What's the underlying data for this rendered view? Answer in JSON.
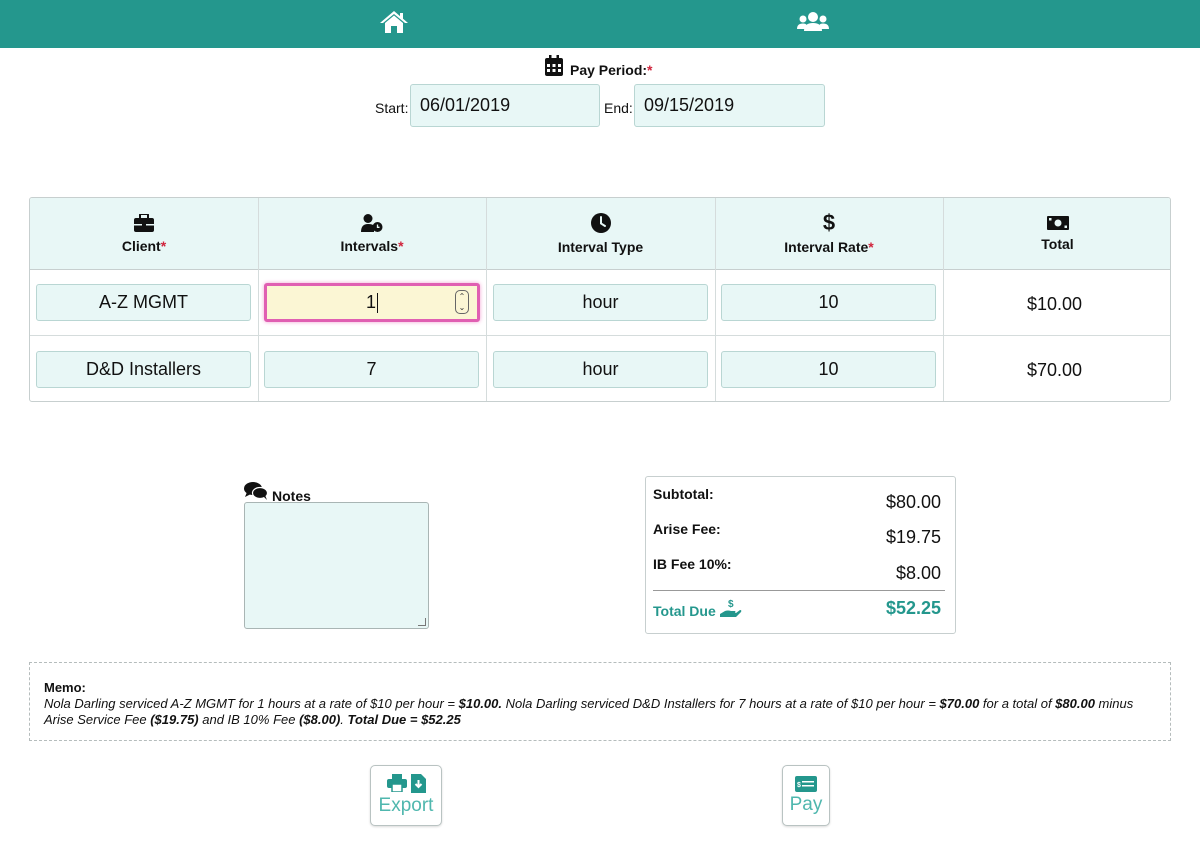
{
  "nav": {
    "home_icon": "home-icon",
    "users_icon": "users-icon"
  },
  "pay_period": {
    "title": "Pay Period:",
    "required_mark": "*",
    "start_label": "Start:",
    "start_value": "06/01/2019",
    "end_label": "End:",
    "end_value": "09/15/2019"
  },
  "table": {
    "headers": [
      {
        "label": "Client",
        "required": "*",
        "icon": "briefcase-icon"
      },
      {
        "label": "Intervals",
        "required": "*",
        "icon": "user-clock-icon"
      },
      {
        "label": "Interval Type",
        "required": "",
        "icon": "clock-icon"
      },
      {
        "label": "Interval Rate",
        "required": "*",
        "icon": "dollar-icon"
      },
      {
        "label": "Total",
        "required": "",
        "icon": "money-bill-icon"
      }
    ],
    "rows": [
      {
        "client": "A-Z MGMT",
        "intervals": "1",
        "interval_type": "hour",
        "rate": "10",
        "total": "$10.00"
      },
      {
        "client": "D&D Installers",
        "intervals": "7",
        "interval_type": "hour",
        "rate": "10",
        "total": "$70.00"
      }
    ]
  },
  "notes": {
    "label": "Notes",
    "value": ""
  },
  "summary": {
    "subtotal_label": "Subtotal:",
    "subtotal": "$80.00",
    "arise_fee_label": "Arise Fee:",
    "arise_fee": "$19.75",
    "ib_fee_label": "IB Fee 10%:",
    "ib_fee": "$8.00",
    "total_due_label": "Total Due",
    "total_due": "$52.25"
  },
  "memo": {
    "label": "Memo:",
    "parts": {
      "p1": "Nola Darling serviced A-Z MGMT for 1 hours at a rate of $10 per hour = ",
      "b1": "$10.00.",
      "p2": " Nola Darling serviced D&D Installers for 7 hours at a rate of $10 per hour = ",
      "b2": "$70.00",
      "p3": " for a total of ",
      "b3": "$80.00",
      "p4": " minus Arise Service Fee ",
      "b4": "($19.75)",
      "p5": " and IB 10% Fee ",
      "b5": "($8.00)",
      "p6": ". ",
      "b6": "Total Due = $52.25"
    }
  },
  "buttons": {
    "export_label": "Export",
    "pay_label": "Pay"
  },
  "colors": {
    "brand_teal": "#24978d",
    "required_red": "#d0243c",
    "field_bg": "#e8f7f6",
    "active_field_bg": "#fbf6d4",
    "active_border": "#e05fb2"
  }
}
